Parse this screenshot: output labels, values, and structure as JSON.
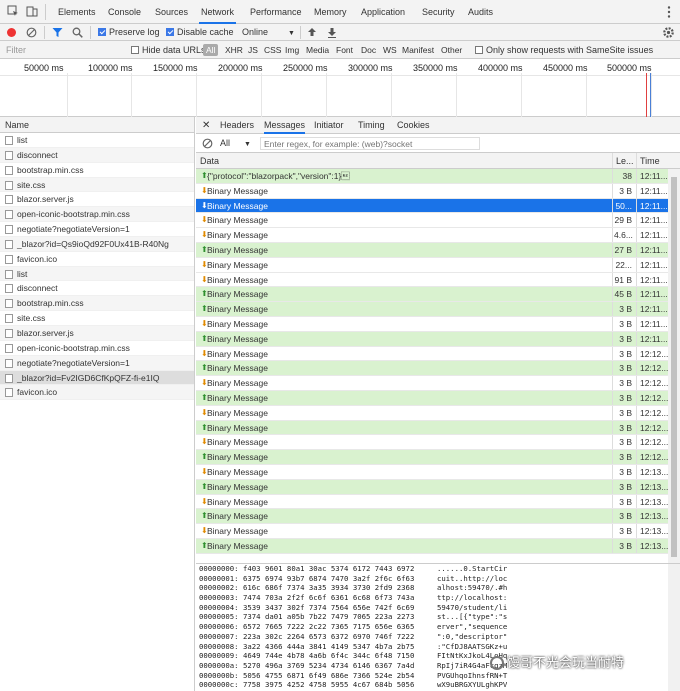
{
  "devtools_tabs": [
    "Elements",
    "Console",
    "Sources",
    "Network",
    "Performance",
    "Memory",
    "Application",
    "Security",
    "Audits"
  ],
  "active_tab": "Network",
  "toolbar": {
    "preserve_log": "Preserve log",
    "disable_cache": "Disable cache",
    "throttling": "Online"
  },
  "filter": {
    "placeholder": "Filter",
    "hide_data_urls": "Hide data URLs",
    "types": [
      "All",
      "XHR",
      "JS",
      "CSS",
      "Img",
      "Media",
      "Font",
      "Doc",
      "WS",
      "Manifest",
      "Other"
    ],
    "samesite": "Only show requests with SameSite issues"
  },
  "timeline_ticks": [
    "50000 ms",
    "100000 ms",
    "150000 ms",
    "200000 ms",
    "250000 ms",
    "300000 ms",
    "350000 ms",
    "400000 ms",
    "450000 ms",
    "500000 ms"
  ],
  "name_header": "Name",
  "requests": [
    "list",
    "disconnect",
    "bootstrap.min.css",
    "site.css",
    "blazor.server.js",
    "open-iconic-bootstrap.min.css",
    "negotiate?negotiateVersion=1",
    "_blazor?id=Qs9ioQd92F0Ux41B-R40Ng",
    "favicon.ico",
    "list",
    "disconnect",
    "bootstrap.min.css",
    "site.css",
    "blazor.server.js",
    "open-iconic-bootstrap.min.css",
    "negotiate?negotiateVersion=1",
    "_blazor?id=Fv2IGD6CfKpQFZ-fi-e1IQ",
    "favicon.ico"
  ],
  "detail_tabs": [
    "Headers",
    "Messages",
    "Initiator",
    "Timing",
    "Cookies"
  ],
  "active_detail_tab": "Messages",
  "message_filter": {
    "selected": "All",
    "placeholder": "Enter regex, for example: (web)?socket"
  },
  "columns": {
    "data": "Data",
    "length": "Le...",
    "time": "Time"
  },
  "messages": [
    {
      "dir": "up",
      "data": "{\"protocol\":\"blazorpack\",\"version\":1}\u001e",
      "len": "38",
      "time": "12:11...",
      "style": "green"
    },
    {
      "dir": "down",
      "data": "Binary Message",
      "len": "3 B",
      "time": "12:11...",
      "style": "white"
    },
    {
      "dir": "down",
      "data": "Binary Message",
      "len": "50...",
      "time": "12:11...",
      "style": "sel"
    },
    {
      "dir": "down",
      "data": "Binary Message",
      "len": "29 B",
      "time": "12:11...",
      "style": "white"
    },
    {
      "dir": "down",
      "data": "Binary Message",
      "len": "4.6...",
      "time": "12:11...",
      "style": "white"
    },
    {
      "dir": "up",
      "data": "Binary Message",
      "len": "27 B",
      "time": "12:11...",
      "style": "green"
    },
    {
      "dir": "down",
      "data": "Binary Message",
      "len": "22...",
      "time": "12:11...",
      "style": "white"
    },
    {
      "dir": "down",
      "data": "Binary Message",
      "len": "91 B",
      "time": "12:11...",
      "style": "white"
    },
    {
      "dir": "up",
      "data": "Binary Message",
      "len": "45 B",
      "time": "12:11...",
      "style": "green"
    },
    {
      "dir": "up",
      "data": "Binary Message",
      "len": "3 B",
      "time": "12:11...",
      "style": "green"
    },
    {
      "dir": "down",
      "data": "Binary Message",
      "len": "3 B",
      "time": "12:11...",
      "style": "white"
    },
    {
      "dir": "up",
      "data": "Binary Message",
      "len": "3 B",
      "time": "12:11...",
      "style": "green"
    },
    {
      "dir": "down",
      "data": "Binary Message",
      "len": "3 B",
      "time": "12:12...",
      "style": "white"
    },
    {
      "dir": "up",
      "data": "Binary Message",
      "len": "3 B",
      "time": "12:12...",
      "style": "green"
    },
    {
      "dir": "down",
      "data": "Binary Message",
      "len": "3 B",
      "time": "12:12...",
      "style": "white"
    },
    {
      "dir": "up",
      "data": "Binary Message",
      "len": "3 B",
      "time": "12:12...",
      "style": "green"
    },
    {
      "dir": "down",
      "data": "Binary Message",
      "len": "3 B",
      "time": "12:12...",
      "style": "white"
    },
    {
      "dir": "up",
      "data": "Binary Message",
      "len": "3 B",
      "time": "12:12...",
      "style": "green"
    },
    {
      "dir": "down",
      "data": "Binary Message",
      "len": "3 B",
      "time": "12:12...",
      "style": "white"
    },
    {
      "dir": "up",
      "data": "Binary Message",
      "len": "3 B",
      "time": "12:12...",
      "style": "green"
    },
    {
      "dir": "down",
      "data": "Binary Message",
      "len": "3 B",
      "time": "12:13...",
      "style": "white"
    },
    {
      "dir": "up",
      "data": "Binary Message",
      "len": "3 B",
      "time": "12:13...",
      "style": "green"
    },
    {
      "dir": "down",
      "data": "Binary Message",
      "len": "3 B",
      "time": "12:13...",
      "style": "white"
    },
    {
      "dir": "up",
      "data": "Binary Message",
      "len": "3 B",
      "time": "12:13...",
      "style": "green"
    },
    {
      "dir": "down",
      "data": "Binary Message",
      "len": "3 B",
      "time": "12:13...",
      "style": "white"
    },
    {
      "dir": "up",
      "data": "Binary Message",
      "len": "3 B",
      "time": "12:13...",
      "style": "green"
    }
  ],
  "hexdump": [
    {
      "addr": "00000000:",
      "hex": "f403 9601 80a1 30ac 5374 6172 7443 6972",
      "ascii": "......0.StartCir"
    },
    {
      "addr": "00000001:",
      "hex": "6375 6974 93b7 6874 7470 3a2f 2f6c 6f63",
      "ascii": "cuit..http://loc"
    },
    {
      "addr": "00000002:",
      "hex": "616c 686f 7374 3a35 3934 3730 2fd9 2368",
      "ascii": "alhost:59470/.#h"
    },
    {
      "addr": "00000003:",
      "hex": "7474 703a 2f2f 6c6f 6361 6c68 6f73 743a",
      "ascii": "ttp://localhost:"
    },
    {
      "addr": "00000004:",
      "hex": "3539 3437 302f 7374 7564 656e 742f 6c69",
      "ascii": "59470/student/li"
    },
    {
      "addr": "00000005:",
      "hex": "7374 da01 a05b 7b22 7479 7065 223a 2273",
      "ascii": "st...[{\"type\":\"s"
    },
    {
      "addr": "00000006:",
      "hex": "6572 7665 7222 2c22 7365 7175 656e 6365",
      "ascii": "erver\",\"sequence"
    },
    {
      "addr": "00000007:",
      "hex": "223a 302c 2264 6573 6372 6970 746f 7222",
      "ascii": "\":0,\"descriptor\""
    },
    {
      "addr": "00000008:",
      "hex": "3a22 4366 444a 3841 4149 5347 4b7a 2b75",
      "ascii": ":\"CfDJ8AATSGKz+u"
    },
    {
      "addr": "00000009:",
      "hex": "4649 744e 4b78 4a6b 6f4c 344c 6f48 7150",
      "ascii": "FItNtKxJkoL4LoHq"
    },
    {
      "addr": "0000000a:",
      "hex": "5270 496a 3769 5234 4734 6146 6367 7a4d",
      "ascii": "RpIj7iR4G4aFcgzM"
    },
    {
      "addr": "0000000b:",
      "hex": "5056 4755 6871 6f49 686e 7366 524e 2b54",
      "ascii": "PVGUhqoIhnsfRN+T"
    },
    {
      "addr": "0000000c:",
      "hex": "7758 3975 4252 4758 5955 4c67 684b 5056",
      "ascii": "wX9uBRGXYULghKPV"
    }
  ],
  "watermark": "馒哥不光会玩当耐特"
}
